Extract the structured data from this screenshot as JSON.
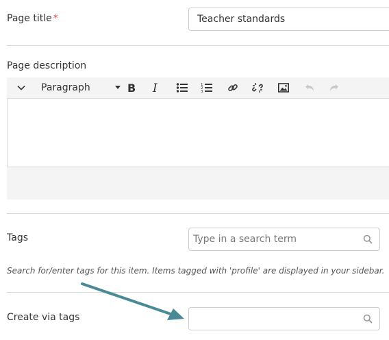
{
  "page_title": {
    "label": "Page title",
    "required_mark": "*",
    "value": "Teacher standards"
  },
  "page_description": {
    "label": "Page description",
    "toolbar": {
      "toggle_icon": "chevron-down-icon",
      "format_value": "Paragraph",
      "buttons": [
        {
          "name": "bold",
          "icon": "bold-icon"
        },
        {
          "name": "italic",
          "icon": "italic-icon"
        },
        {
          "name": "bullet-list",
          "icon": "bullet-list-icon"
        },
        {
          "name": "numbered-list",
          "icon": "numbered-list-icon"
        },
        {
          "name": "link",
          "icon": "link-icon"
        },
        {
          "name": "unlink",
          "icon": "unlink-icon"
        },
        {
          "name": "image",
          "icon": "image-icon"
        },
        {
          "name": "undo",
          "icon": "undo-icon",
          "disabled": true
        },
        {
          "name": "redo",
          "icon": "redo-icon",
          "disabled": true
        }
      ]
    },
    "content": ""
  },
  "tags": {
    "label": "Tags",
    "placeholder": "Type in a search term",
    "help_text": "Search for/enter tags for this item. Items tagged with 'profile' are displayed in your sidebar."
  },
  "create_via_tags": {
    "label": "Create via tags",
    "value": ""
  },
  "annotation": {
    "arrow_color": "#4a8a96"
  },
  "colors": {
    "required": "#d9534f",
    "border": "#cccccc",
    "toolbar_bg": "#f4f4f4",
    "text": "#333333"
  }
}
